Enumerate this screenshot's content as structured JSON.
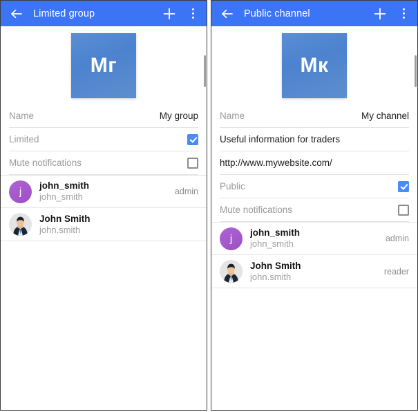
{
  "panels": [
    {
      "appbar": {
        "back_icon": "arrow-left-icon",
        "title": "Limited group",
        "add_icon": "plus-icon",
        "more_icon": "overflow-menu-icon",
        "background": "#3b74f5"
      },
      "avatar": {
        "initials": "Mг",
        "gradient_from": "#5b8fd4",
        "gradient_to": "#5d8ecd"
      },
      "rows": [
        {
          "type": "value",
          "label": "Name",
          "value": "My group"
        },
        {
          "type": "checkbox",
          "label": "Limited",
          "checked": true
        },
        {
          "type": "checkbox",
          "label": "Mute notifications",
          "checked": false
        }
      ],
      "members": [
        {
          "avatar_type": "letter",
          "avatar_letter": "j",
          "avatar_color": "#a45cc9",
          "title": "john_smith",
          "subtitle": "john_smith",
          "role": "admin"
        },
        {
          "avatar_type": "photo",
          "avatar_letter": "",
          "title": "John Smith",
          "subtitle": "john.smith",
          "role": ""
        }
      ]
    },
    {
      "appbar": {
        "back_icon": "arrow-left-icon",
        "title": "Public channel",
        "add_icon": "plus-icon",
        "more_icon": "overflow-menu-icon",
        "background": "#3b74f5"
      },
      "avatar": {
        "initials": "Мк",
        "gradient_from": "#5b8fd4",
        "gradient_to": "#5d8ecd"
      },
      "rows": [
        {
          "type": "value",
          "label": "Name",
          "value": "My channel"
        },
        {
          "type": "text",
          "label": "",
          "value": "Useful information for traders"
        },
        {
          "type": "text",
          "label": "",
          "value": "http://www.mywebsite.com/"
        },
        {
          "type": "checkbox",
          "label": "Public",
          "checked": true
        },
        {
          "type": "checkbox",
          "label": "Mute notifications",
          "checked": false
        }
      ],
      "members": [
        {
          "avatar_type": "letter",
          "avatar_letter": "j",
          "avatar_color": "#a45cc9",
          "title": "john_smith",
          "subtitle": "john_smith",
          "role": "admin"
        },
        {
          "avatar_type": "photo",
          "avatar_letter": "",
          "title": "John Smith",
          "subtitle": "john.smith",
          "role": "reader"
        }
      ]
    }
  ]
}
